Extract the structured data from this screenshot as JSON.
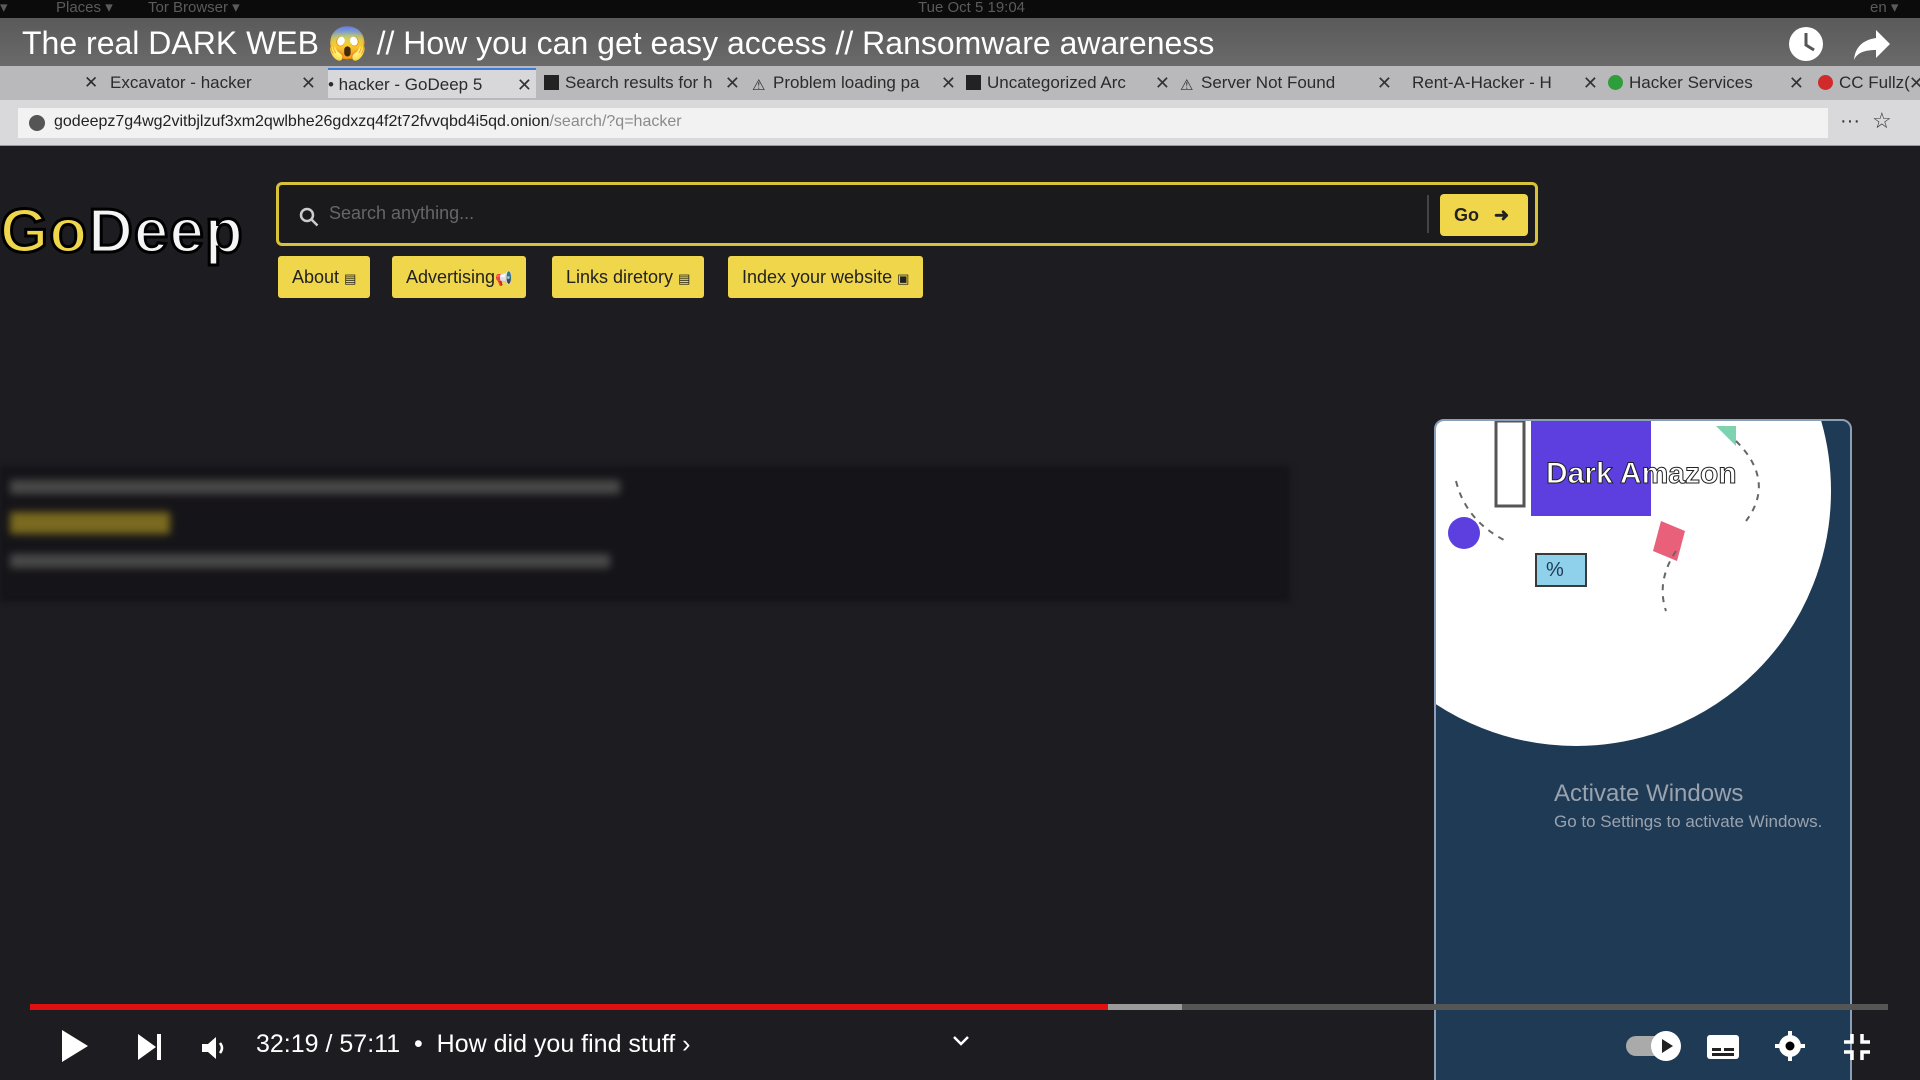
{
  "gnome_bar": {
    "places": "Places ▾",
    "browser": "Tor Browser ▾",
    "clock": "Tue Oct 5  19:04",
    "lang": "en ▾"
  },
  "video_title": "The real DARK WEB 😱 // How you can get easy access // Ransomware awareness",
  "tabs": [
    {
      "label": "Excavator - hacker",
      "icon": "none"
    },
    {
      "label": "• hacker - GoDeep 5",
      "icon": "none",
      "active": true
    },
    {
      "label": "Search results for h",
      "icon": "site-icon"
    },
    {
      "label": "Problem loading pa",
      "icon": "warning-icon"
    },
    {
      "label": "Uncategorized Arc",
      "icon": "site-icon"
    },
    {
      "label": "Server Not Found",
      "icon": "warning-icon"
    },
    {
      "label": "Rent-A-Hacker - H",
      "icon": "none"
    },
    {
      "label": "Hacker Services",
      "icon": "green-dot-icon"
    },
    {
      "label": "CC Fullz(",
      "icon": "red-dot-icon"
    }
  ],
  "url": {
    "host": "godeepz7g4wg2vitbjlzuf3xm2qwlbhe26gdxzq4f2t72fvvqbd4i5qd.onion",
    "path": "/search/?q=hacker"
  },
  "site": {
    "logo_go": "Go",
    "logo_deep": "Deep",
    "search_placeholder": "Search anything...",
    "go_label": "Go",
    "nav": [
      "About",
      "Advertising",
      "Links diretory",
      "Index your website"
    ]
  },
  "ad": {
    "brand": "Dark Amazon",
    "percent": "%"
  },
  "watermark": {
    "line1": "Activate Windows",
    "line2": "Go to Settings to activate Windows."
  },
  "player": {
    "time": "32:19 / 57:11",
    "chapter": "How did you find stuff",
    "progress_played": 0.58,
    "progress_loaded": 0.62
  },
  "colors": {
    "accent": "#f0d64a",
    "progress": "#e01010",
    "ad_bg": "#1f3a55"
  }
}
